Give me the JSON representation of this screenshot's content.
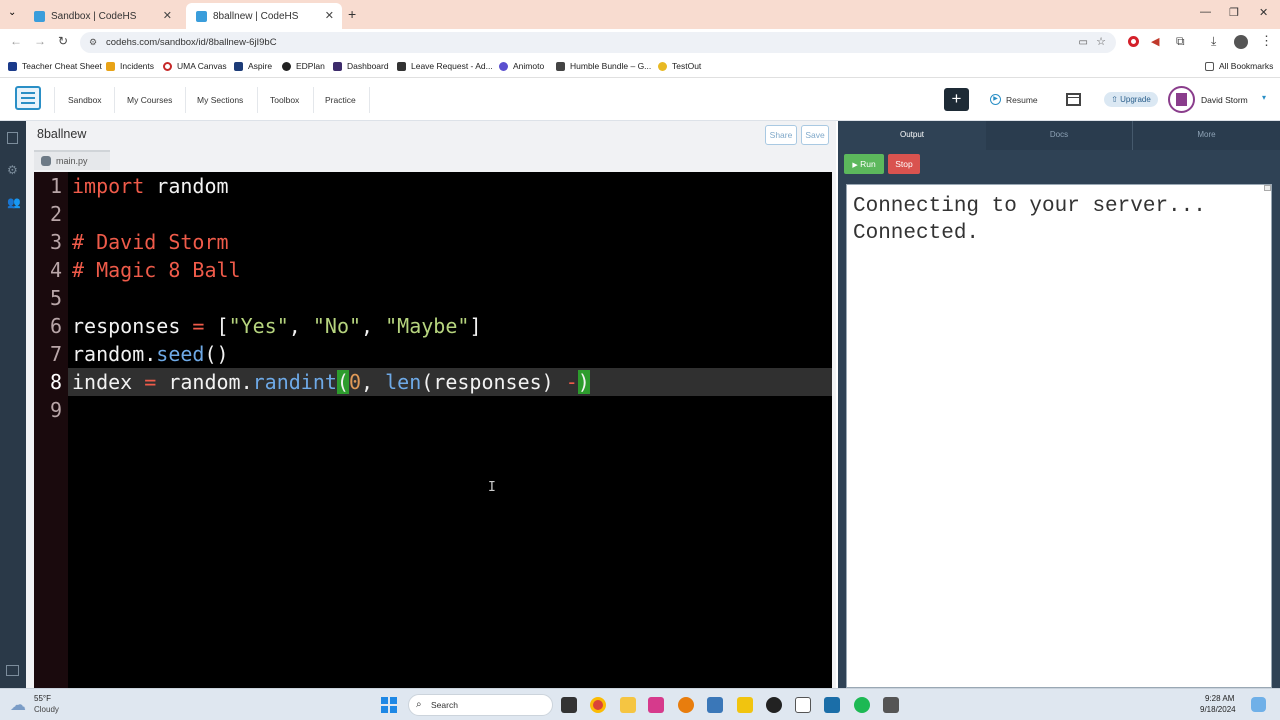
{
  "browser": {
    "tabs": [
      {
        "title": "Sandbox | CodeHS",
        "active": false
      },
      {
        "title": "8ballnew | CodeHS",
        "active": true
      }
    ],
    "url": "codehs.com/sandbox/id/8ballnew-6jI9bC",
    "bookmarks": [
      "Teacher Cheat Sheet",
      "Incidents",
      "UMA Canvas",
      "Aspire",
      "EDPlan",
      "Dashboard",
      "Leave Request - Ad...",
      "Animoto",
      "Humble Bundle – G...",
      "TestOut"
    ],
    "all_bookmarks": "All Bookmarks"
  },
  "header": {
    "nav": [
      "Sandbox",
      "My Courses",
      "My Sections",
      "Toolbox",
      "Practice"
    ],
    "resume": "Resume",
    "upgrade": "Upgrade",
    "user": "David Storm"
  },
  "editor": {
    "project_name": "8ballnew",
    "share": "Share",
    "save": "Save",
    "file_tab": "main.py",
    "line_numbers": [
      "1",
      "2",
      "3",
      "4",
      "5",
      "6",
      "7",
      "8",
      "9"
    ]
  },
  "right_panel": {
    "tabs": [
      "Output",
      "Docs",
      "More"
    ],
    "run": "Run",
    "stop": "Stop",
    "console_lines": [
      "Connecting to your server...",
      "Connected."
    ]
  },
  "taskbar": {
    "weather_temp": "55°F",
    "weather_desc": "Cloudy",
    "search": "Search",
    "time": "9:28 AM",
    "date": "9/18/2024"
  },
  "colors": {
    "accent_green": "#5cb85c",
    "stop_red": "#d9534f",
    "panel_dark": "#2f4255"
  }
}
